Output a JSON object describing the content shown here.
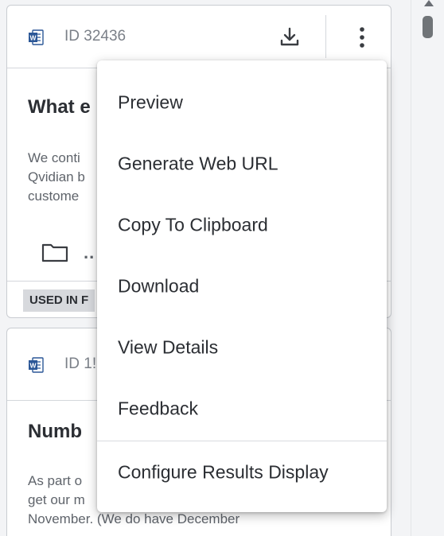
{
  "cards": [
    {
      "id_text": "ID 32436",
      "title": "What e",
      "snippet": [
        "We conti",
        "Qvidian b",
        "custome"
      ],
      "more": "..",
      "badge": "USED IN F"
    },
    {
      "id_text": "ID 1!",
      "title": "Numb",
      "snippet": [
        "As part o",
        "get our m",
        "November. (We do have December"
      ]
    }
  ],
  "menu": {
    "items": [
      "Preview",
      "Generate Web URL",
      "Copy To Clipboard",
      "Download",
      "View Details",
      "Feedback",
      "Configure Results Display"
    ]
  },
  "icons": {
    "doc": "word-document-icon",
    "download": "download-icon",
    "more": "kebab-menu-icon",
    "folder": "folder-icon"
  },
  "colors": {
    "word_blue": "#2b5797",
    "text_dark": "#2b2e33",
    "text_muted": "#5f646b",
    "badge_bg": "#d7d9dd"
  }
}
